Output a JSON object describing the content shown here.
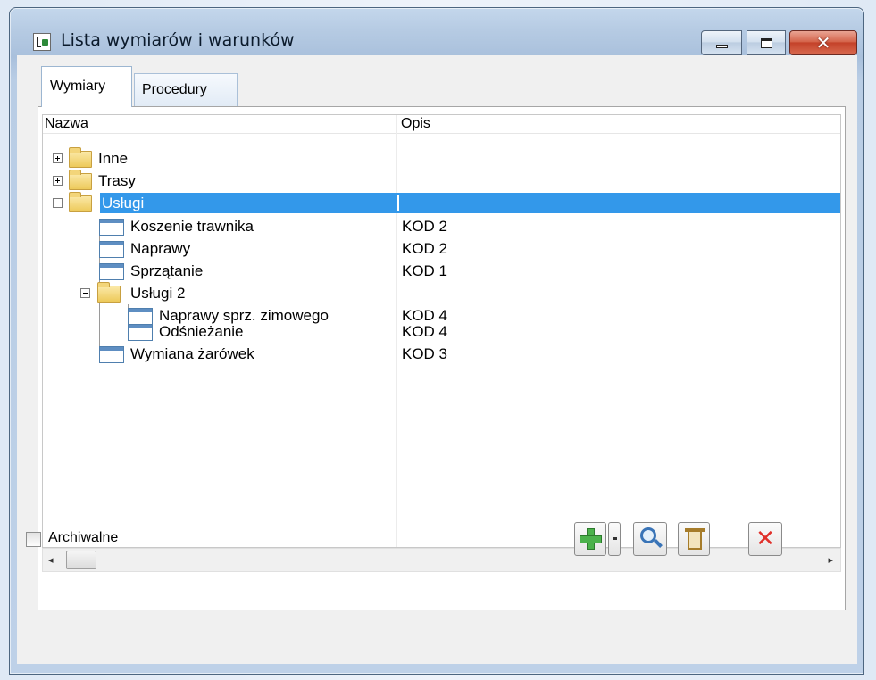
{
  "window": {
    "title": "Lista wymiarów i warunków",
    "close_glyph": "✕"
  },
  "tabs": [
    {
      "label": "Wymiary",
      "active": true
    },
    {
      "label": "Procedury",
      "active": false
    }
  ],
  "columns": {
    "name_header": "Nazwa",
    "description_header": "Opis"
  },
  "tree": [
    {
      "label": "Inne",
      "description": "",
      "type": "folder",
      "expander": "plus"
    },
    {
      "label": "Trasy",
      "description": "",
      "type": "folder",
      "expander": "plus"
    },
    {
      "label": "Usługi",
      "description": "",
      "type": "folder",
      "expander": "minus",
      "selected": true
    },
    {
      "label": "Koszenie trawnika",
      "description": "KOD 2",
      "type": "item"
    },
    {
      "label": "Naprawy",
      "description": "KOD 2",
      "type": "item"
    },
    {
      "label": "Sprzątanie",
      "description": "KOD 1",
      "type": "item"
    },
    {
      "label": "Usługi 2",
      "description": "",
      "type": "folder",
      "expander": "minus"
    },
    {
      "label": "Naprawy sprz. zimowego",
      "description": "KOD 4",
      "type": "item"
    },
    {
      "label": "Odśnieżanie",
      "description": "KOD 4",
      "type": "item"
    },
    {
      "label": "Wymiana żarówek",
      "description": "KOD 3",
      "type": "item"
    }
  ],
  "scrollbar": {
    "left_arrow": "◂",
    "right_arrow": "▸"
  },
  "footer": {
    "archive_label": "Archiwalne",
    "archive_checked": false,
    "cancel_glyph": "✕"
  },
  "colors": {
    "selection": "#3398ea",
    "add_icon": "#4bb24b",
    "cancel_icon": "#e0302a",
    "close_button": "#c4422a"
  }
}
